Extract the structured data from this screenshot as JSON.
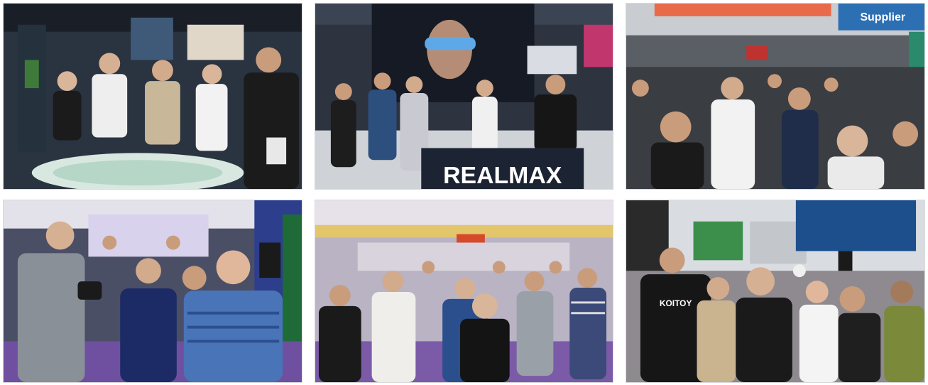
{
  "photos": [
    {
      "scene": "exhibition-hall-interactive-table"
    },
    {
      "scene": "realmax-booth",
      "booth_sign": "REALMAX"
    },
    {
      "scene": "crowded-exhibition-aisle",
      "top_right_sign": "Supplier"
    },
    {
      "scene": "visitors-with-camera"
    },
    {
      "scene": "exhibition-hall-aisle-crowd"
    },
    {
      "scene": "crowd-near-display-screen",
      "shirt_text": "KOITOY"
    }
  ],
  "colors": {
    "background": "#ffffff",
    "hall_purple": "#6b4fa0",
    "booth_dark": "#1c2433",
    "crowd_dark": "#2b2b2b"
  }
}
